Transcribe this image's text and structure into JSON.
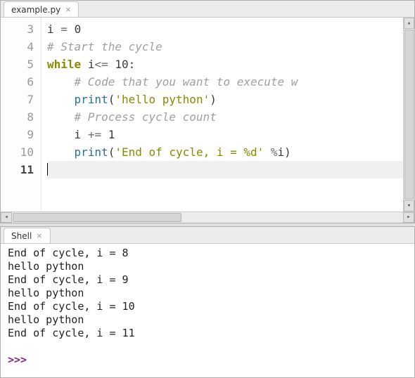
{
  "editor": {
    "tab_label": "example.py",
    "lines": [
      {
        "n": 3,
        "tokens": [
          [
            "nm",
            "i"
          ],
          [
            "sp",
            " "
          ],
          [
            "op",
            "="
          ],
          [
            "sp",
            " "
          ],
          [
            "num",
            "0"
          ]
        ]
      },
      {
        "n": 4,
        "tokens": [
          [
            "cm",
            "# Start the cycle"
          ]
        ]
      },
      {
        "n": 5,
        "tokens": [
          [
            "kw",
            "while"
          ],
          [
            "sp",
            " "
          ],
          [
            "nm",
            "i"
          ],
          [
            "op",
            "<="
          ],
          [
            "sp",
            " "
          ],
          [
            "num",
            "10"
          ],
          [
            "nm",
            ":"
          ]
        ]
      },
      {
        "n": 6,
        "tokens": [
          [
            "sp",
            "    "
          ],
          [
            "cm",
            "# Code that you want to execute w"
          ]
        ]
      },
      {
        "n": 7,
        "tokens": [
          [
            "sp",
            "    "
          ],
          [
            "fn",
            "print"
          ],
          [
            "nm",
            "("
          ],
          [
            "str",
            "'hello python'"
          ],
          [
            "nm",
            ")"
          ]
        ]
      },
      {
        "n": 8,
        "tokens": [
          [
            "sp",
            "    "
          ],
          [
            "cm",
            "# Process cycle count"
          ]
        ]
      },
      {
        "n": 9,
        "tokens": [
          [
            "sp",
            "    "
          ],
          [
            "nm",
            "i"
          ],
          [
            "sp",
            " "
          ],
          [
            "op",
            "+="
          ],
          [
            "sp",
            " "
          ],
          [
            "num",
            "1"
          ]
        ]
      },
      {
        "n": 10,
        "tokens": [
          [
            "sp",
            "    "
          ],
          [
            "fn",
            "print"
          ],
          [
            "nm",
            "("
          ],
          [
            "str",
            "'End of cycle, i = %d'"
          ],
          [
            "sp",
            " "
          ],
          [
            "op",
            "%"
          ],
          [
            "nm",
            "i)"
          ]
        ]
      },
      {
        "n": 11,
        "tokens": [],
        "current": true
      }
    ]
  },
  "shell": {
    "tab_label": "Shell",
    "output": [
      "End of cycle, i = 8",
      "hello python",
      "End of cycle, i = 9",
      "hello python",
      "End of cycle, i = 10",
      "hello python",
      "End of cycle, i = 11"
    ],
    "prompt": ">>>"
  }
}
